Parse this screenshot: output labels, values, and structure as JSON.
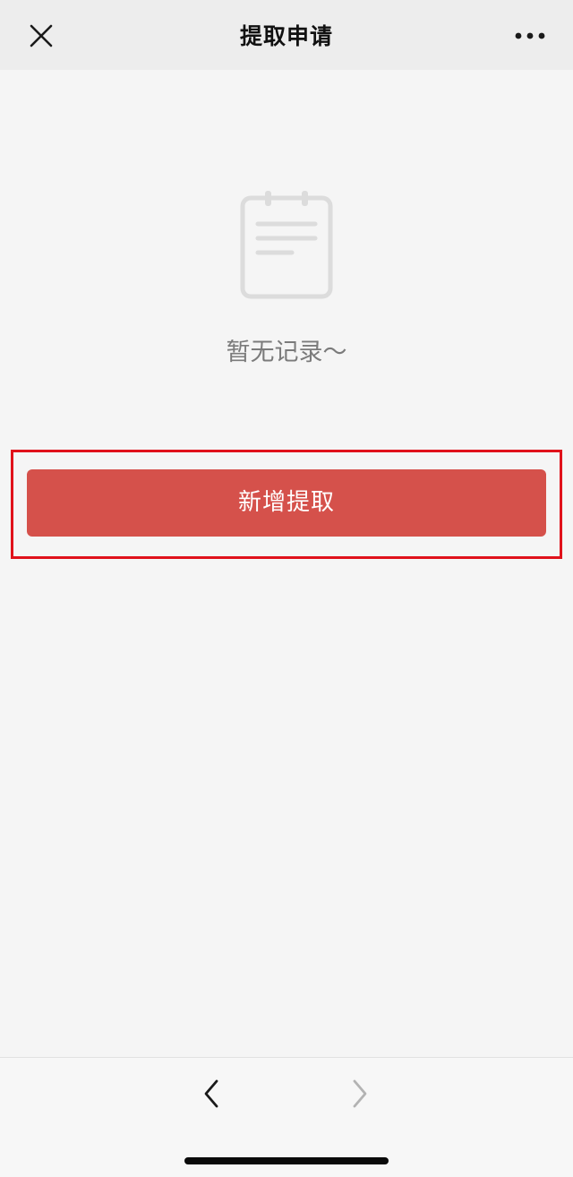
{
  "header": {
    "title": "提取申请",
    "close_icon": "close-icon",
    "more_icon": "more-dots-icon"
  },
  "empty_state": {
    "icon": "notepad-icon",
    "message": "暂无记录～"
  },
  "primary_action": {
    "label": "新增提取",
    "color": "#d5514b"
  },
  "highlight": {
    "color": "#e0121b"
  },
  "toolbar": {
    "back_icon": "chevron-left-icon",
    "forward_icon": "chevron-right-icon",
    "forward_enabled": false
  }
}
